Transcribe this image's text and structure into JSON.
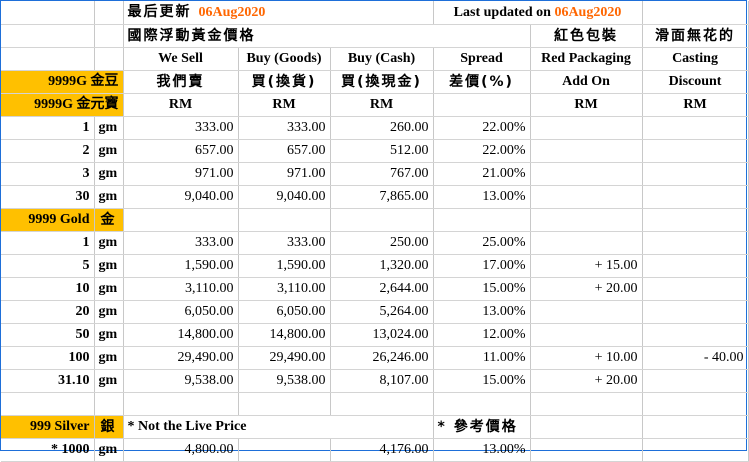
{
  "colors": {
    "gold": "#ffc000",
    "orange": "#ff6600"
  },
  "header": {
    "last_update_label": "最后更新",
    "date": "06Aug2020",
    "last_updated_en": "Last updated on",
    "title_cn": "國際浮動黃金價格"
  },
  "columns": {
    "we_sell": "We Sell",
    "we_sell_cn": "我們賣",
    "buy_goods": "Buy (Goods)",
    "buy_goods_cn": "買(換貨)",
    "buy_cash": "Buy (Cash)",
    "buy_cash_cn": "買(換現金)",
    "spread": "Spread",
    "spread_cn": "差價(%)",
    "red_pkg_cn": "紅色包裝",
    "red_pkg": "Red Packaging",
    "add_on": "Add On",
    "casting_cn": "滑面無花的",
    "casting": "Casting",
    "discount": "Discount",
    "unit": "RM"
  },
  "sections": {
    "s9999g_1": "9999G 金豆",
    "s9999g_2": "9999G 金元寶",
    "s9999gold": "9999 Gold",
    "s9999gold_cn": "金",
    "s999silver": "999 Silver",
    "s999silver_cn": "銀"
  },
  "unit_gm": "gm",
  "group1": [
    {
      "w": "1",
      "sell": "333.00",
      "goods": "333.00",
      "cash": "260.00",
      "spread": "22.00%",
      "addon": "",
      "disc": ""
    },
    {
      "w": "2",
      "sell": "657.00",
      "goods": "657.00",
      "cash": "512.00",
      "spread": "22.00%",
      "addon": "",
      "disc": ""
    },
    {
      "w": "3",
      "sell": "971.00",
      "goods": "971.00",
      "cash": "767.00",
      "spread": "21.00%",
      "addon": "",
      "disc": ""
    },
    {
      "w": "30",
      "sell": "9,040.00",
      "goods": "9,040.00",
      "cash": "7,865.00",
      "spread": "13.00%",
      "addon": "",
      "disc": ""
    }
  ],
  "group2": [
    {
      "w": "1",
      "sell": "333.00",
      "goods": "333.00",
      "cash": "250.00",
      "spread": "25.00%",
      "addon": "",
      "disc": ""
    },
    {
      "w": "5",
      "sell": "1,590.00",
      "goods": "1,590.00",
      "cash": "1,320.00",
      "spread": "17.00%",
      "addon": "+ 15.00",
      "disc": ""
    },
    {
      "w": "10",
      "sell": "3,110.00",
      "goods": "3,110.00",
      "cash": "2,644.00",
      "spread": "15.00%",
      "addon": "+ 20.00",
      "disc": ""
    },
    {
      "w": "20",
      "sell": "6,050.00",
      "goods": "6,050.00",
      "cash": "5,264.00",
      "spread": "13.00%",
      "addon": "",
      "disc": ""
    },
    {
      "w": "50",
      "sell": "14,800.00",
      "goods": "14,800.00",
      "cash": "13,024.00",
      "spread": "12.00%",
      "addon": "",
      "disc": ""
    },
    {
      "w": "100",
      "sell": "29,490.00",
      "goods": "29,490.00",
      "cash": "26,246.00",
      "spread": "11.00%",
      "addon": "+ 10.00",
      "disc": "- 40.00"
    },
    {
      "w": "31.10",
      "sell": "9,538.00",
      "goods": "9,538.00",
      "cash": "8,107.00",
      "spread": "15.00%",
      "addon": "+ 20.00",
      "disc": ""
    }
  ],
  "notes": {
    "not_live": "* Not the Live Price",
    "ref_price": "* 參考價格"
  },
  "silver": {
    "w": "*  1000",
    "sell": "4,800.00",
    "goods": "",
    "cash": "4,176.00",
    "spread": "13.00%"
  }
}
